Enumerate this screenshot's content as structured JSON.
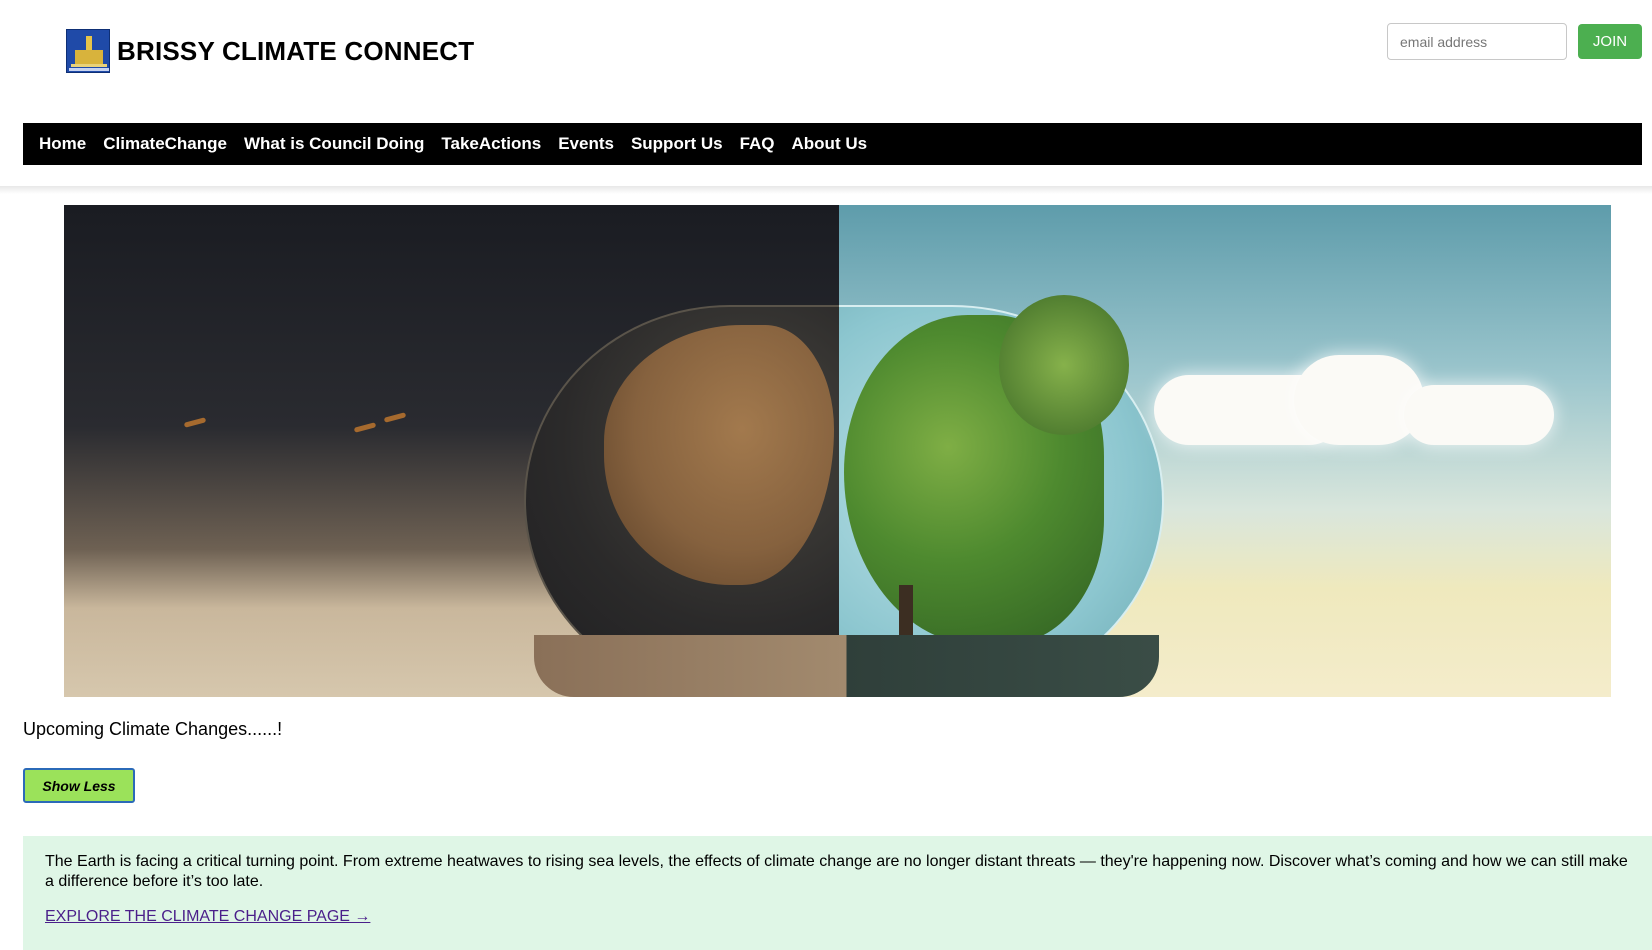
{
  "header": {
    "site_title": "BRISSY CLIMATE CONNECT",
    "logo_icon": "brisbane-city-logo",
    "email_placeholder": "email address",
    "join_label": "JOIN"
  },
  "nav": {
    "items": [
      {
        "label": "Home"
      },
      {
        "label": "ClimateChange"
      },
      {
        "label": "What is Council Doing"
      },
      {
        "label": "TakeActions"
      },
      {
        "label": "Events"
      },
      {
        "label": "Support Us"
      },
      {
        "label": "FAQ"
      },
      {
        "label": "About Us"
      }
    ]
  },
  "hero": {
    "image": "split-earth-desert-vs-green-tree-image"
  },
  "content": {
    "upcoming_text": "Upcoming Climate Changes......!",
    "show_less_label": "Show Less",
    "info_text": "The Earth is facing a critical turning point. From extreme heatwaves to rising sea levels, the effects of climate change are no longer distant threats — they're happening now. Discover what’s coming and how we can still make a difference before it’s too late.",
    "explore_link": "EXPLORE THE CLIMATE CHANGE PAGE →"
  },
  "colors": {
    "nav_bg": "#000000",
    "join_bg": "#4caf50",
    "show_less_bg": "#9be25a",
    "info_bg": "#dff6e6",
    "link": "#4a1f8a"
  }
}
